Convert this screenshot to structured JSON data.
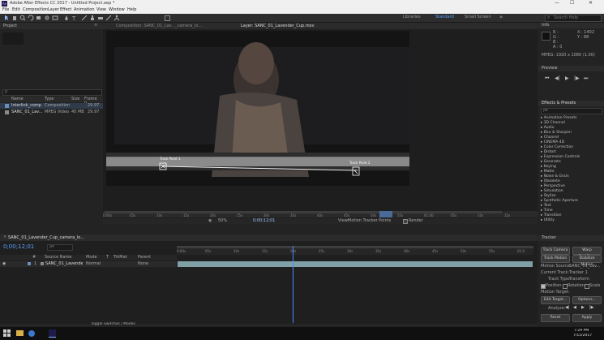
{
  "window": {
    "title": "Adobe After Effects CC 2017 - Untitled Project.aep *",
    "controls": [
      "—",
      "☐",
      "✕"
    ]
  },
  "menu": [
    "File",
    "Edit",
    "Composition",
    "Layer",
    "Effect",
    "Animation",
    "View",
    "Window",
    "Help"
  ],
  "workspaces": {
    "items": [
      "Libraries",
      "Standard",
      "Small Screen"
    ],
    "active": "Standard",
    "search_placeholder": "Search Help"
  },
  "project_panel": {
    "title": "Project",
    "search_placeholder": "ρ",
    "columns": [
      "Name",
      "Type",
      "Size",
      "Frame R..."
    ],
    "rows": [
      {
        "name": "Interlink_comp",
        "type": "Composition",
        "size": "",
        "rate": "29.97"
      },
      {
        "name": "SANC_01_Lav...",
        "type": "MPEG Video",
        "size": "45 MB",
        "rate": "29.97"
      }
    ]
  },
  "viewer": {
    "tabs": [
      "Composition: SANC_01_Lav..._camera_lo...",
      "Layer: SANC_01_Lavender_Cup.mov"
    ],
    "tracking_points": [
      "Track Point 1",
      "Track Point 2"
    ],
    "zoom": "50%",
    "timecode": "0;00;12;01",
    "view_label": "View:",
    "view_value": "Motion Tracker Points",
    "render_label": "Render",
    "ruler_labels": [
      "0:00s",
      "05s",
      "10s",
      "15s",
      "20s",
      "25s",
      "30s",
      "35s",
      "40s",
      "45s",
      "50s",
      "55s",
      "01:00",
      "05s",
      "10s",
      "15s"
    ]
  },
  "info_panel": {
    "title": "Info",
    "values": [
      "R :",
      "G :",
      "B :",
      "A : 0"
    ],
    "coords": [
      "X : 1402",
      "Y : 88"
    ],
    "status": "MPEG: 1920 x 1080 (1.00)"
  },
  "preview_panel": {
    "title": "Preview",
    "buttons": [
      "⏮",
      "◀|",
      "▶",
      "|▶",
      "⏭"
    ]
  },
  "effects_panel": {
    "title": "Effects & Presets",
    "search_placeholder": "ρ▾",
    "items": [
      "▸ Animation Presets",
      "▸ 3D Channel",
      "▸ Audio",
      "▸ Blur & Sharpen",
      "▸ Channel",
      "▸ CINEMA 4D",
      "▸ Color Correction",
      "▸ Distort",
      "▸ Expression Controls",
      "▸ Generate",
      "▸ Keying",
      "▸ Matte",
      "▸ Noise & Grain",
      "▸ Obsolete",
      "▸ Perspective",
      "▸ Simulation",
      "▸ Stylize",
      "▸ Synthetic Aperture",
      "▸ Text",
      "▸ Time",
      "▸ Transition",
      "▸ Utility"
    ]
  },
  "tracker_panel": {
    "title": "Tracker",
    "buttons_row1": [
      "Track Camera",
      "Warp Stabilizer"
    ],
    "buttons_row2": [
      "Track Motion",
      "Stabilize Motion"
    ],
    "motion_source_label": "Motion Source:",
    "motion_source_value": "SANC_01_Lav...",
    "current_track_label": "Current Track:",
    "current_track_value": "Tracker 1",
    "track_type_label": "Track Type:",
    "track_type_value": "Transform",
    "checks": [
      "Position",
      "Rotation",
      "Scale"
    ],
    "motion_target_label": "Motion Target:",
    "motion_target_value": "",
    "buttons_row3": [
      "Edit Target...",
      "Options..."
    ],
    "analyze_label": "Analyze:",
    "analyze_buttons": [
      "◀|",
      "◀",
      "▶",
      "|▶"
    ],
    "buttons_row4": [
      "Reset",
      "Apply"
    ]
  },
  "timeline": {
    "comp_tab": "SANC_01_Lavender_Cup_camera_lo...",
    "timecode": "0;00;12;01",
    "search_placeholder": "ρ▾",
    "columns": [
      "#",
      "Source Name",
      "Mode",
      "T",
      "TrkMat",
      "Parent"
    ],
    "layer": {
      "index": "1",
      "name": "SANC_01_Lavender...",
      "mode": "Normal",
      "parent": "None"
    },
    "ruler": [
      "0:00s",
      "05s",
      "10s",
      "15s",
      "20s",
      "25s",
      "30s",
      "35s",
      "40s",
      "45s",
      "50s",
      "55s",
      "01:0"
    ],
    "footer": "Toggle Switches / Modes"
  },
  "taskbar": {
    "time": "7:29 PM",
    "date": "7/15/2017"
  }
}
